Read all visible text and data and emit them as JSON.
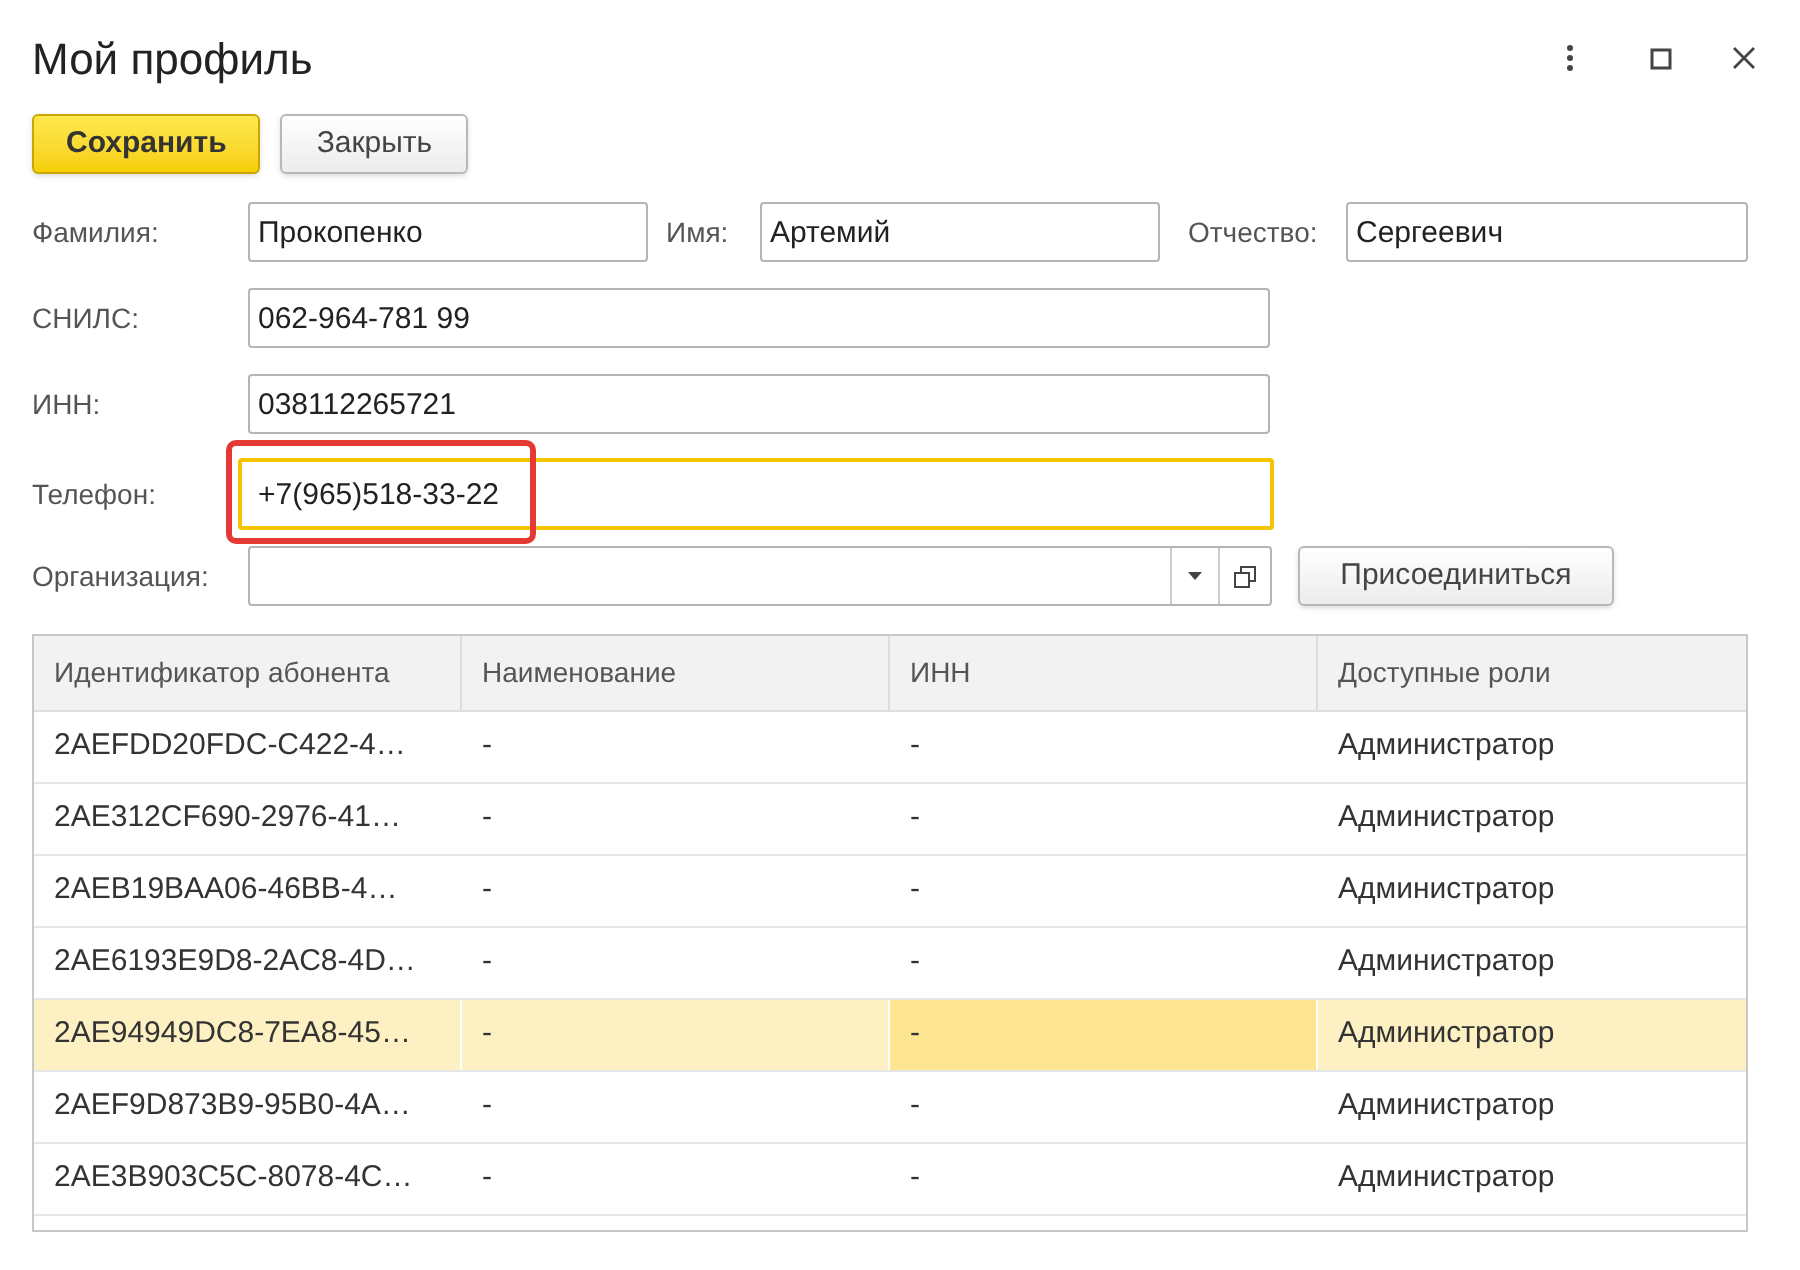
{
  "window": {
    "title": "Мой профиль"
  },
  "buttons": [
    {
      "label": "Сохранить",
      "kind": "primary"
    },
    {
      "label": "Закрыть",
      "kind": "normal"
    }
  ],
  "name_row": [
    {
      "label": "Фамилия:",
      "value": "Прокопенко"
    },
    {
      "label": "Имя:",
      "value": "Артемий"
    },
    {
      "label": "Отчество:",
      "value": "Сергеевич"
    }
  ],
  "fields": [
    {
      "label": "СНИЛС:",
      "value": "062-964-781 99",
      "focused": false,
      "highlighted": false
    },
    {
      "label": "ИНН:",
      "value": "038112265721",
      "focused": false,
      "highlighted": false
    },
    {
      "label": "Телефон:",
      "value": "+7(965)518-33-22",
      "focused": true,
      "highlighted": true
    }
  ],
  "organization": {
    "label": "Организация:",
    "button": "Присоединиться"
  },
  "table": {
    "columns": [
      {
        "label": "Идентификатор абонента",
        "selected": false
      },
      {
        "label": "Наименование",
        "selected": false
      },
      {
        "label": "ИНН",
        "selected": true
      },
      {
        "label": "Доступные роли",
        "selected": false
      }
    ],
    "rows": [
      {
        "cells": [
          "2AEFDD20FDC-C422-4…",
          "-",
          "-",
          "Администратор"
        ],
        "selected": false
      },
      {
        "cells": [
          "2AE312CF690-2976-41…",
          "-",
          "-",
          "Администратор"
        ],
        "selected": false
      },
      {
        "cells": [
          "2AEB19BAA06-46BB-4…",
          "-",
          "-",
          "Администратор"
        ],
        "selected": false
      },
      {
        "cells": [
          "2AE6193E9D8-2AC8-4D…",
          "-",
          "-",
          "Администратор"
        ],
        "selected": false
      },
      {
        "cells": [
          "2AE94949DC8-7EA8-45…",
          "-",
          "-",
          "Администратор"
        ],
        "selected": true
      },
      {
        "cells": [
          "2AEF9D873B9-95B0-4A…",
          "-",
          "-",
          "Администратор"
        ],
        "selected": false
      },
      {
        "cells": [
          "2AE3B903C5C-8078-4C…",
          "-",
          "-",
          "Администратор"
        ],
        "selected": false
      }
    ]
  }
}
